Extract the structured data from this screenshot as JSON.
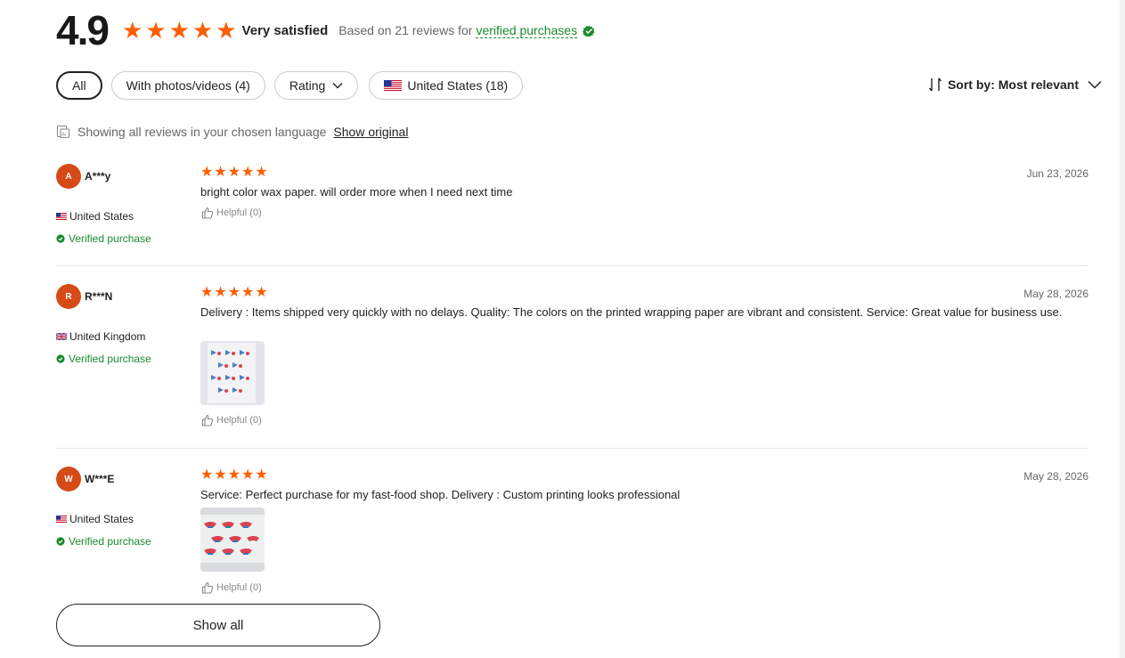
{
  "summary": {
    "rating": "4.9",
    "star_count": 5,
    "satisfaction": "Very satisfied",
    "based_on": "Based on 21 reviews for",
    "verified_link": "verified purchases",
    "accent_color": "#fd5e00",
    "verified_color": "#1b8a2d"
  },
  "filters": {
    "all": "All",
    "photos": "With photos/videos (4)",
    "rating": "Rating",
    "country": "United States (18)"
  },
  "sort": {
    "label": "Sort by: Most relevant"
  },
  "language": {
    "note": "Showing all reviews in your chosen language",
    "show_original": "Show original"
  },
  "reviews": [
    {
      "initial": "A",
      "name": "A***y",
      "country": "United States",
      "flag": "us",
      "verified": "Verified purchase",
      "stars": 5,
      "date": "Jun 23, 2026",
      "text": "bright color wax paper. will order more when I need next time",
      "helpful": "Helpful (0)"
    },
    {
      "initial": "R",
      "name": "R***N",
      "country": "United Kingdom",
      "flag": "uk",
      "verified": "Verified purchase",
      "stars": 5,
      "date": "May 28, 2026",
      "text": "Delivery : Items shipped very quickly with no delays.  Quality: The colors on the printed wrapping paper are vibrant and consistent.  Service: Great value for business use.",
      "helpful": "Helpful (0)"
    },
    {
      "initial": "W",
      "name": "W***E",
      "country": "United States",
      "flag": "us",
      "verified": "Verified purchase",
      "stars": 5,
      "date": "May 28, 2026",
      "text": "Service: Perfect purchase for my fast-food shop.  Delivery : Custom printing looks professional",
      "helpful": "Helpful (0)"
    }
  ],
  "show_all": "Show all"
}
